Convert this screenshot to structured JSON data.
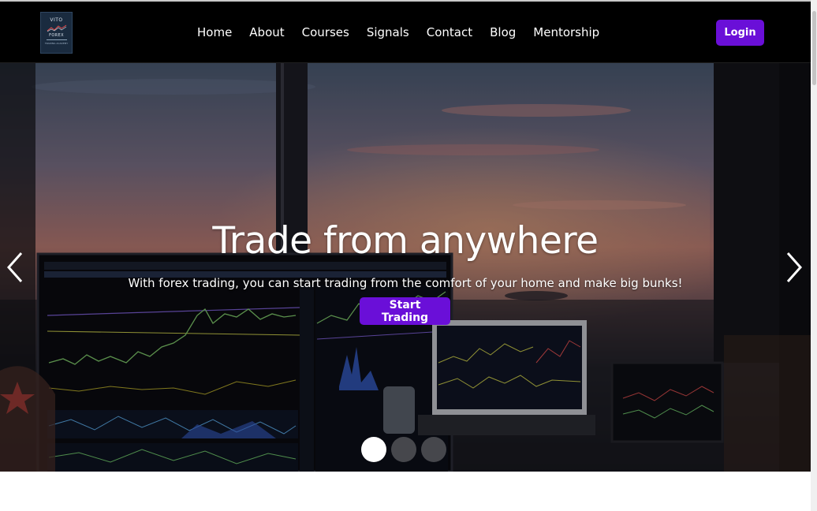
{
  "brand": {
    "logo_line1": "VITO",
    "logo_line2": "FOREX",
    "logo_tagline": "TRADING ACADEMY"
  },
  "nav": {
    "items": [
      {
        "label": "Home"
      },
      {
        "label": "About"
      },
      {
        "label": "Courses"
      },
      {
        "label": "Signals"
      },
      {
        "label": "Contact"
      },
      {
        "label": "Blog"
      },
      {
        "label": "Mentorship"
      }
    ],
    "login_label": "Login"
  },
  "hero": {
    "title": "Trade from anywhere",
    "subtitle": "With forex trading, you can start trading from the comfort of your home and make big bunks!",
    "cta_label": "Start Trading",
    "slides_count": 3,
    "active_slide": 1
  },
  "icons": {
    "prev": "chevron-left-icon",
    "next": "chevron-right-icon"
  },
  "colors": {
    "accent": "#6a0fd8",
    "navbar_bg": "#000000",
    "logo_bg": "#1a2b3f"
  }
}
